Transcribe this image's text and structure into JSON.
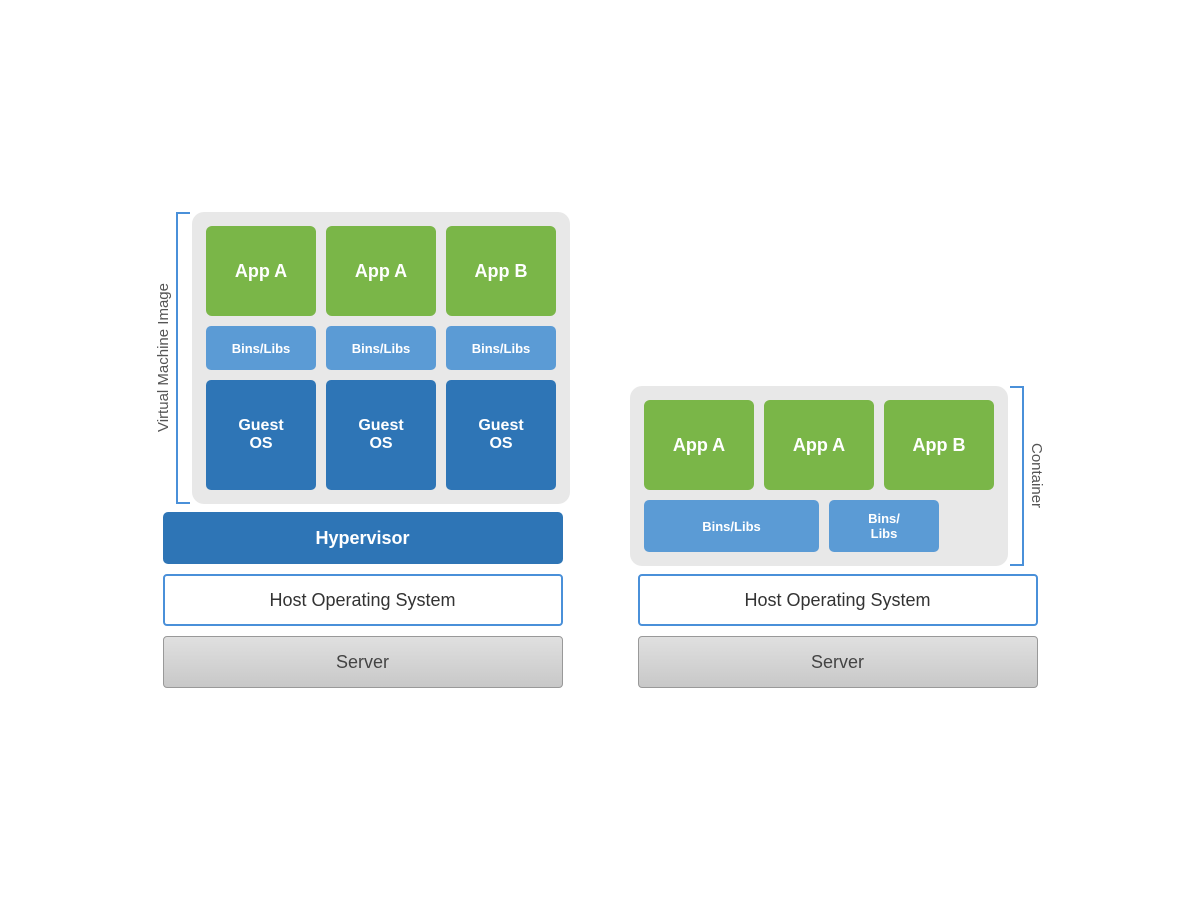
{
  "left": {
    "vm_label": "Virtual Machine Image",
    "apps": [
      "App A",
      "App A",
      "App B"
    ],
    "bins": [
      "Bins/Libs",
      "Bins/Libs",
      "Bins/Libs"
    ],
    "guest": [
      "Guest\nOS",
      "Guest\nOS",
      "Guest\nOS"
    ],
    "hypervisor": "Hypervisor",
    "host_os": "Host Operating System",
    "server": "Server"
  },
  "right": {
    "container_label": "Container",
    "apps": [
      "App A",
      "App A",
      "App B"
    ],
    "bins_wide": "Bins/Libs",
    "bins_small": "Bins/\nLibs",
    "host_os": "Host Operating System",
    "server": "Server"
  }
}
